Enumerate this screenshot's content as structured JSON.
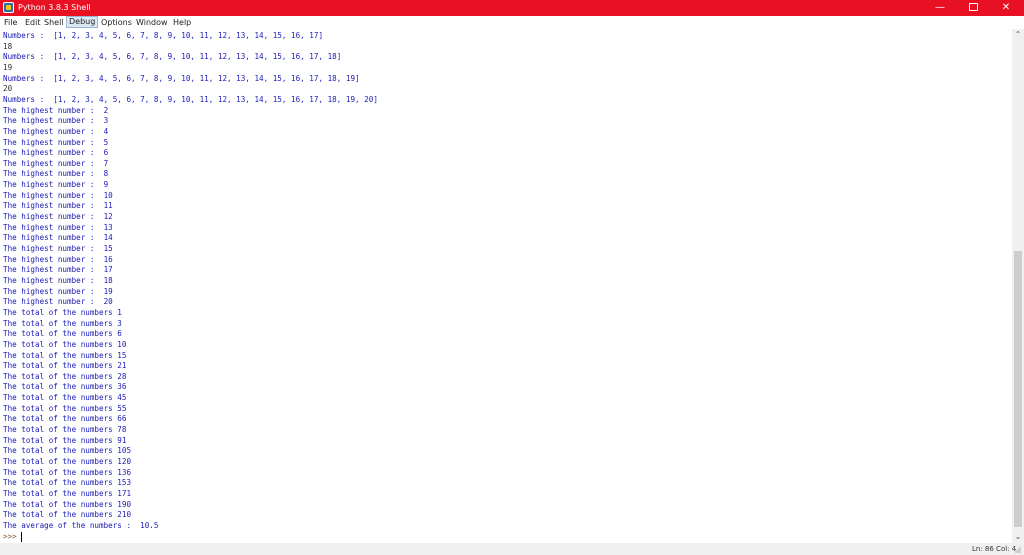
{
  "window": {
    "title": "Python 3.8.3 Shell",
    "minimize": "—",
    "close": "✕"
  },
  "menubar": [
    "File",
    "Edit",
    "Shell",
    "Debug",
    "Options",
    "Window",
    "Help"
  ],
  "shell_lines": [
    {
      "text": "Numbers :  [1, 2, 3, 4, 5, 6, 7, 8, 9, 10, 11, 12, 13, 14, 15, 16, 17]",
      "kind": "out"
    },
    {
      "text": "18",
      "kind": "num"
    },
    {
      "text": "Numbers :  [1, 2, 3, 4, 5, 6, 7, 8, 9, 10, 11, 12, 13, 14, 15, 16, 17, 18]",
      "kind": "out"
    },
    {
      "text": "19",
      "kind": "num"
    },
    {
      "text": "Numbers :  [1, 2, 3, 4, 5, 6, 7, 8, 9, 10, 11, 12, 13, 14, 15, 16, 17, 18, 19]",
      "kind": "out"
    },
    {
      "text": "20",
      "kind": "num"
    },
    {
      "text": "Numbers :  [1, 2, 3, 4, 5, 6, 7, 8, 9, 10, 11, 12, 13, 14, 15, 16, 17, 18, 19, 20]",
      "kind": "out"
    },
    {
      "text": "The highest number :  2",
      "kind": "out"
    },
    {
      "text": "The highest number :  3",
      "kind": "out"
    },
    {
      "text": "The highest number :  4",
      "kind": "out"
    },
    {
      "text": "The highest number :  5",
      "kind": "out"
    },
    {
      "text": "The highest number :  6",
      "kind": "out"
    },
    {
      "text": "The highest number :  7",
      "kind": "out"
    },
    {
      "text": "The highest number :  8",
      "kind": "out"
    },
    {
      "text": "The highest number :  9",
      "kind": "out"
    },
    {
      "text": "The highest number :  10",
      "kind": "out"
    },
    {
      "text": "The highest number :  11",
      "kind": "out"
    },
    {
      "text": "The highest number :  12",
      "kind": "out"
    },
    {
      "text": "The highest number :  13",
      "kind": "out"
    },
    {
      "text": "The highest number :  14",
      "kind": "out"
    },
    {
      "text": "The highest number :  15",
      "kind": "out"
    },
    {
      "text": "The highest number :  16",
      "kind": "out"
    },
    {
      "text": "The highest number :  17",
      "kind": "out"
    },
    {
      "text": "The highest number :  18",
      "kind": "out"
    },
    {
      "text": "The highest number :  19",
      "kind": "out"
    },
    {
      "text": "The highest number :  20",
      "kind": "out"
    },
    {
      "text": "The total of the numbers 1",
      "kind": "out"
    },
    {
      "text": "The total of the numbers 3",
      "kind": "out"
    },
    {
      "text": "The total of the numbers 6",
      "kind": "out"
    },
    {
      "text": "The total of the numbers 10",
      "kind": "out"
    },
    {
      "text": "The total of the numbers 15",
      "kind": "out"
    },
    {
      "text": "The total of the numbers 21",
      "kind": "out"
    },
    {
      "text": "The total of the numbers 28",
      "kind": "out"
    },
    {
      "text": "The total of the numbers 36",
      "kind": "out"
    },
    {
      "text": "The total of the numbers 45",
      "kind": "out"
    },
    {
      "text": "The total of the numbers 55",
      "kind": "out"
    },
    {
      "text": "The total of the numbers 66",
      "kind": "out"
    },
    {
      "text": "The total of the numbers 78",
      "kind": "out"
    },
    {
      "text": "The total of the numbers 91",
      "kind": "out"
    },
    {
      "text": "The total of the numbers 105",
      "kind": "out"
    },
    {
      "text": "The total of the numbers 120",
      "kind": "out"
    },
    {
      "text": "The total of the numbers 136",
      "kind": "out"
    },
    {
      "text": "The total of the numbers 153",
      "kind": "out"
    },
    {
      "text": "The total of the numbers 171",
      "kind": "out"
    },
    {
      "text": "The total of the numbers 190",
      "kind": "out"
    },
    {
      "text": "The total of the numbers 210",
      "kind": "out"
    },
    {
      "text": "The average of the numbers :  10.5",
      "kind": "out"
    }
  ],
  "prompt": ">>>",
  "status": {
    "position": "Ln: 86  Col: 4"
  },
  "colors": {
    "titlebar": "#e81123",
    "output": "#1a1ab8",
    "prompt": "#8b5a2b"
  }
}
